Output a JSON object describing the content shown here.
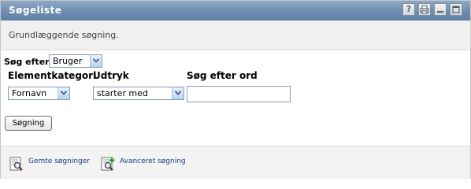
{
  "window": {
    "title": "Søgeliste",
    "buttons": {
      "help": "?",
      "print": "",
      "minimize": "",
      "maximize": ""
    }
  },
  "description": "Grundlæggende søgning.",
  "search_for": {
    "label": "Søg efter:",
    "selected": "Bruger"
  },
  "criteria": {
    "headers": {
      "category": "Elementkategori",
      "expression": "Udtryk",
      "term": "Søg efter ord"
    },
    "category_selected": "Fornavn",
    "expression_selected": "starter med",
    "term_value": ""
  },
  "search_button": "Søgning",
  "footer": {
    "saved_searches": "Gemte søgninger",
    "advanced_search": "Avanceret søgning"
  }
}
